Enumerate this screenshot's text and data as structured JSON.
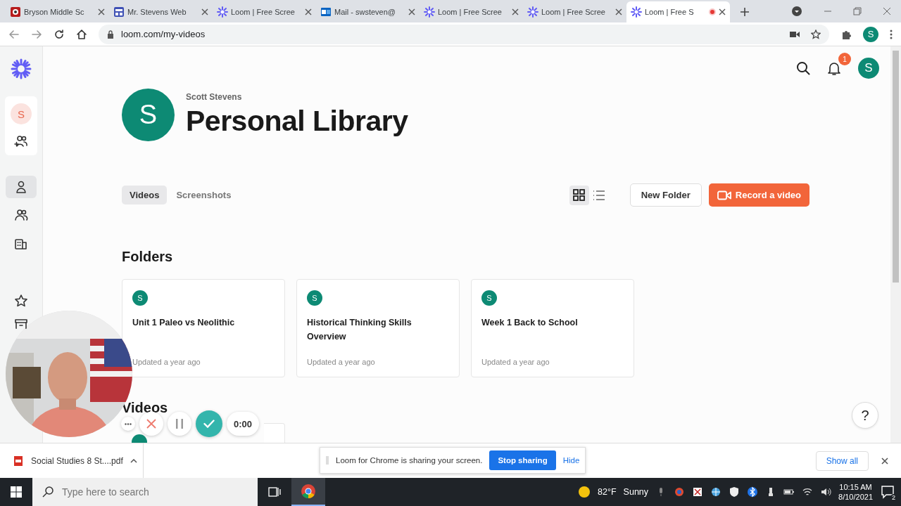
{
  "browser": {
    "tabs": [
      {
        "kind": "school",
        "title": "Bryson Middle Sc",
        "selected": false,
        "recording": false
      },
      {
        "kind": "site",
        "title": "Mr. Stevens Web",
        "selected": false,
        "recording": false
      },
      {
        "kind": "loom",
        "title": "Loom | Free Scree",
        "selected": false,
        "recording": false
      },
      {
        "kind": "mail",
        "title": "Mail - swsteven@",
        "selected": false,
        "recording": false
      },
      {
        "kind": "loom",
        "title": "Loom | Free Scree",
        "selected": false,
        "recording": false
      },
      {
        "kind": "loom",
        "title": "Loom | Free Scree",
        "selected": false,
        "recording": false
      },
      {
        "kind": "loom",
        "title": "Loom | Free S",
        "selected": true,
        "recording": true
      }
    ],
    "url": "loom.com/my-videos",
    "profile": "S"
  },
  "sidebar": {
    "workspace": "S",
    "items": [
      {
        "kind": "person",
        "selected": true
      },
      {
        "kind": "people",
        "selected": false
      },
      {
        "kind": "building",
        "selected": false
      },
      {
        "kind": "star",
        "selected": false
      },
      {
        "kind": "archive",
        "selected": false
      }
    ]
  },
  "header": {
    "notifications": "1",
    "avatar": "S"
  },
  "library": {
    "avatar": "S",
    "owner": "Scott Stevens",
    "title": "Personal Library",
    "tabs": [
      {
        "label": "Videos",
        "selected": true
      },
      {
        "label": "Screenshots",
        "selected": false
      }
    ],
    "view_modes": [
      {
        "kind": "grid",
        "selected": true
      },
      {
        "kind": "list",
        "selected": false
      }
    ],
    "new_folder": "New Folder",
    "record": "Record a video",
    "folders_heading": "Folders",
    "folders": [
      {
        "avatar": "S",
        "name": "Unit 1 Paleo vs Neolithic",
        "updated": "Updated a year ago"
      },
      {
        "avatar": "S",
        "name": "Historical Thinking Skills Overview",
        "updated": "Updated a year ago"
      },
      {
        "avatar": "S",
        "name": "Week 1 Back to School",
        "updated": "Updated a year ago"
      }
    ],
    "videos_heading": "Videos",
    "help": "?"
  },
  "recorder": {
    "timer": "0:00"
  },
  "download_bar": {
    "file": "Social Studies 8 St....pdf",
    "show_all": "Show all"
  },
  "sharing_bar": {
    "message": "Loom for Chrome is sharing your screen.",
    "stop": "Stop sharing",
    "hide": "Hide"
  },
  "taskbar": {
    "search_placeholder": "Type here to search",
    "temperature": "82°F",
    "weather": "Sunny",
    "time": "10:15 AM",
    "date": "8/10/2021",
    "notification_count": "2"
  }
}
